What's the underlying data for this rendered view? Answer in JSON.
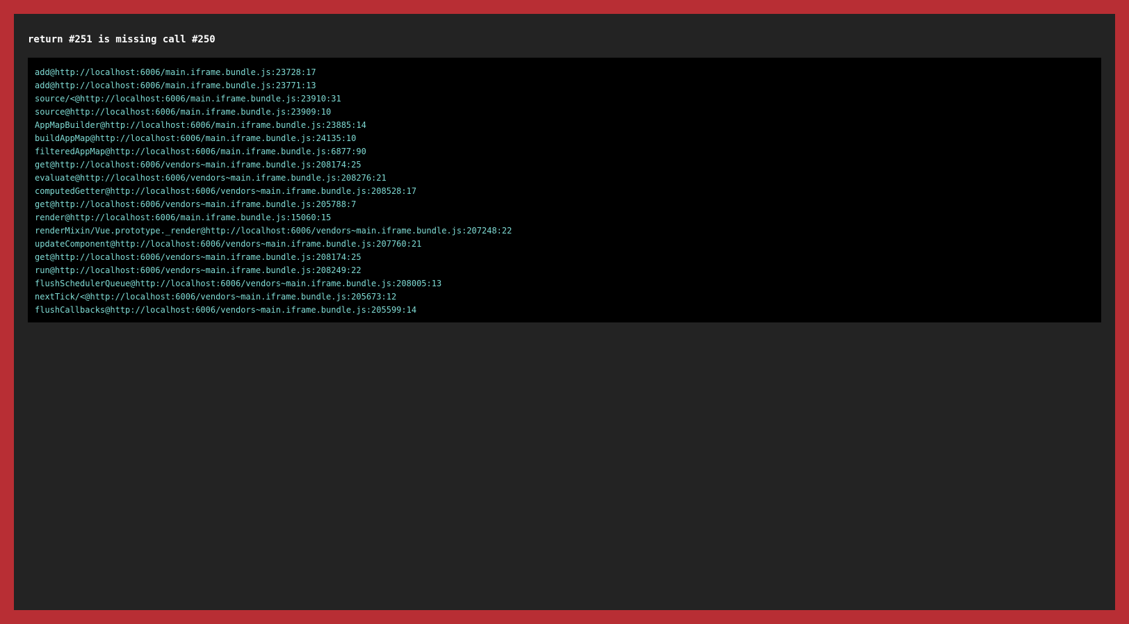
{
  "colors": {
    "frame": "#b82e34",
    "panel": "#232323",
    "stack_background": "#000000",
    "title_text": "#ffffff",
    "stack_text": "#7fdbd4"
  },
  "error": {
    "title": "return #251 is missing call #250",
    "stack": [
      "add@http://localhost:6006/main.iframe.bundle.js:23728:17",
      "add@http://localhost:6006/main.iframe.bundle.js:23771:13",
      "source/<@http://localhost:6006/main.iframe.bundle.js:23910:31",
      "source@http://localhost:6006/main.iframe.bundle.js:23909:10",
      "AppMapBuilder@http://localhost:6006/main.iframe.bundle.js:23885:14",
      "buildAppMap@http://localhost:6006/main.iframe.bundle.js:24135:10",
      "filteredAppMap@http://localhost:6006/main.iframe.bundle.js:6877:90",
      "get@http://localhost:6006/vendors~main.iframe.bundle.js:208174:25",
      "evaluate@http://localhost:6006/vendors~main.iframe.bundle.js:208276:21",
      "computedGetter@http://localhost:6006/vendors~main.iframe.bundle.js:208528:17",
      "get@http://localhost:6006/vendors~main.iframe.bundle.js:205788:7",
      "render@http://localhost:6006/main.iframe.bundle.js:15060:15",
      "renderMixin/Vue.prototype._render@http://localhost:6006/vendors~main.iframe.bundle.js:207248:22",
      "updateComponent@http://localhost:6006/vendors~main.iframe.bundle.js:207760:21",
      "get@http://localhost:6006/vendors~main.iframe.bundle.js:208174:25",
      "run@http://localhost:6006/vendors~main.iframe.bundle.js:208249:22",
      "flushSchedulerQueue@http://localhost:6006/vendors~main.iframe.bundle.js:208005:13",
      "nextTick/<@http://localhost:6006/vendors~main.iframe.bundle.js:205673:12",
      "flushCallbacks@http://localhost:6006/vendors~main.iframe.bundle.js:205599:14"
    ]
  }
}
